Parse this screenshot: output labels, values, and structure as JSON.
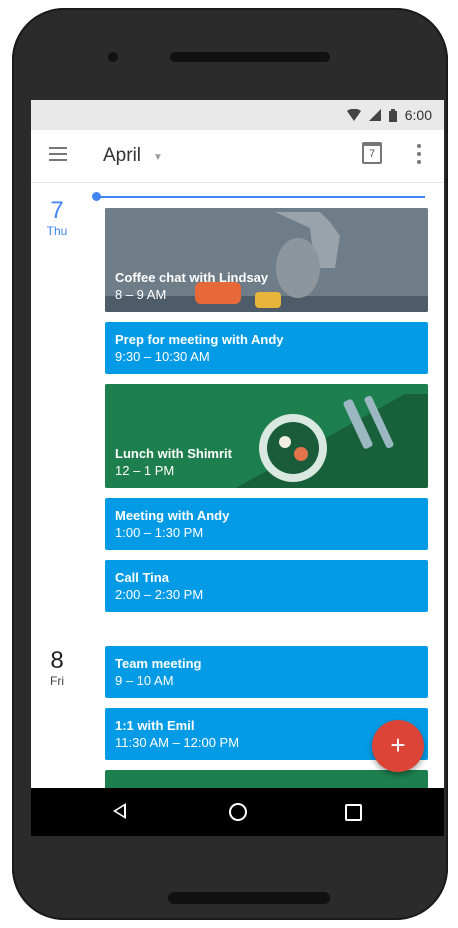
{
  "status_bar": {
    "time": "6:00"
  },
  "app_bar": {
    "month": "April",
    "calendar_icon_day": "7"
  },
  "days": [
    {
      "num": "7",
      "name": "Thu",
      "color": "#4285f4"
    },
    {
      "num": "8",
      "name": "Fri",
      "color": "#212121"
    }
  ],
  "events": [
    {
      "title": "Coffee chat with Lindsay",
      "time": "8 – 9 AM"
    },
    {
      "title": "Prep for meeting with Andy",
      "time": "9:30 – 10:30 AM"
    },
    {
      "title": "Lunch with Shimrit",
      "time": "12 – 1 PM"
    },
    {
      "title": "Meeting with Andy",
      "time": "1:00 – 1:30 PM"
    },
    {
      "title": "Call Tina",
      "time": "2:00 – 2:30 PM"
    },
    {
      "title": "Team meeting",
      "time": "9 – 10 AM"
    },
    {
      "title": "1:1 with Emil",
      "time": "11:30 AM – 12:00 PM"
    }
  ],
  "fab": {
    "label": "+"
  },
  "colors": {
    "event_blue": "#039be5",
    "accent_blue": "#4285f4",
    "fab_red": "#db4437"
  }
}
